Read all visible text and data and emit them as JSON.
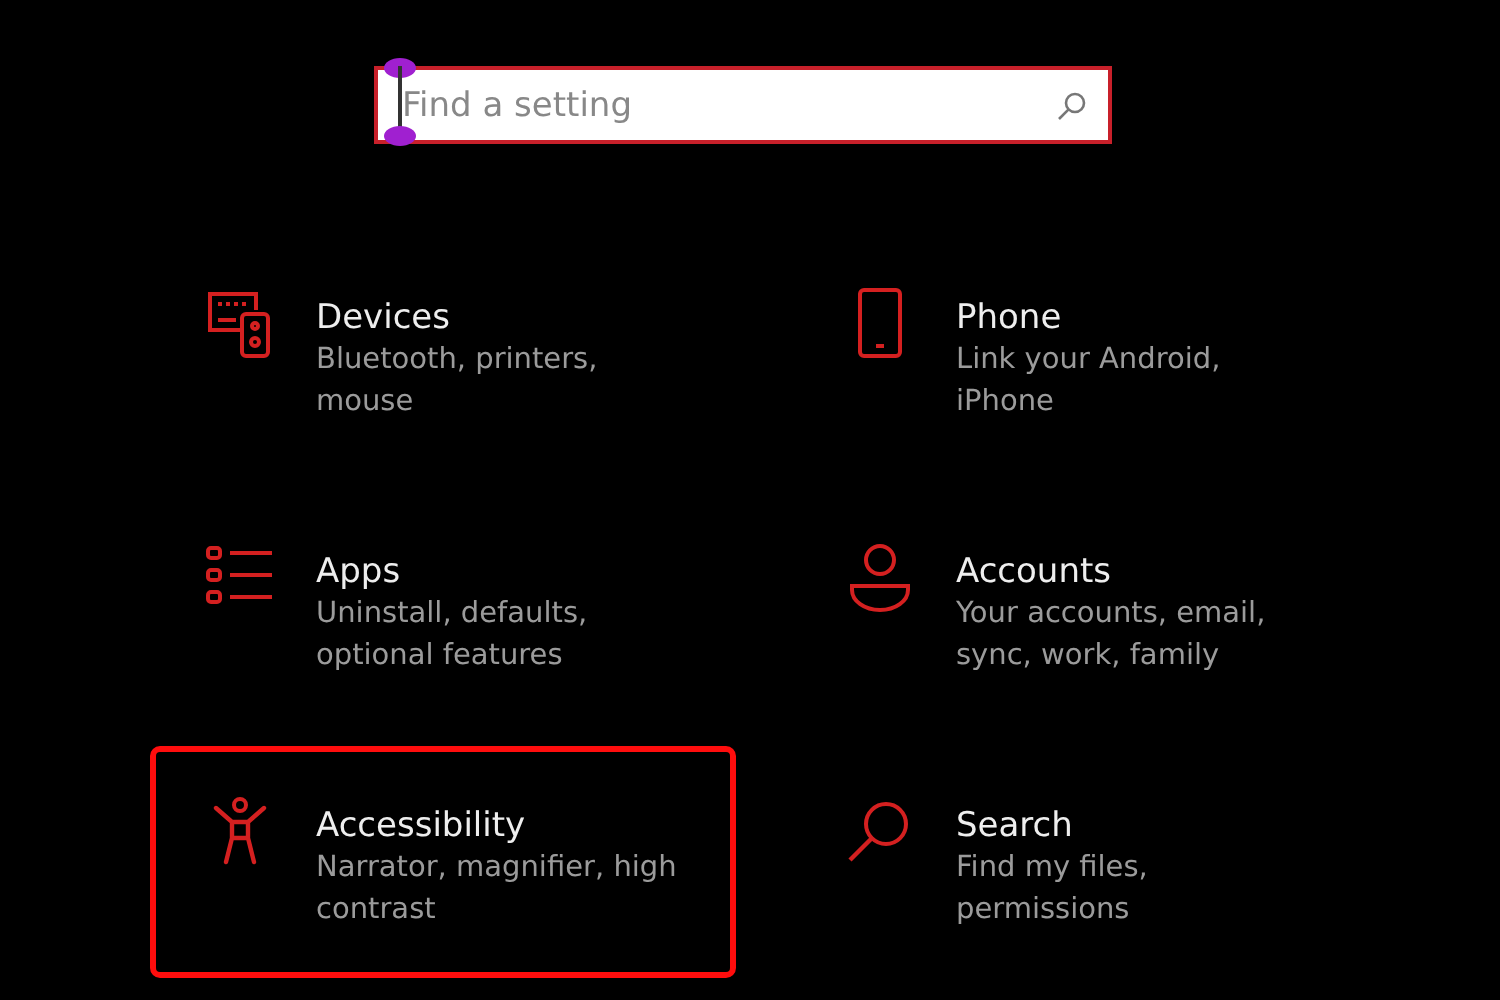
{
  "search": {
    "placeholder": "Find a setting",
    "text_cursor": true
  },
  "categories": [
    {
      "kind": "devices",
      "title": "Devices",
      "description": "Bluetooth, printers, mouse",
      "selected": false
    },
    {
      "kind": "phone",
      "title": "Phone",
      "description": "Link your Android, iPhone",
      "selected": false
    },
    {
      "kind": "apps",
      "title": "Apps",
      "description": "Uninstall, defaults, optional features",
      "selected": false
    },
    {
      "kind": "accounts",
      "title": "Accounts",
      "description": "Your accounts, email, sync, work, family",
      "selected": false
    },
    {
      "kind": "accessibility",
      "title": "Accessibility",
      "description": "Narrator, magnifier, high contrast",
      "selected": true
    },
    {
      "kind": "search",
      "title": "Search",
      "description": "Find my files, permissions",
      "selected": false
    }
  ]
}
